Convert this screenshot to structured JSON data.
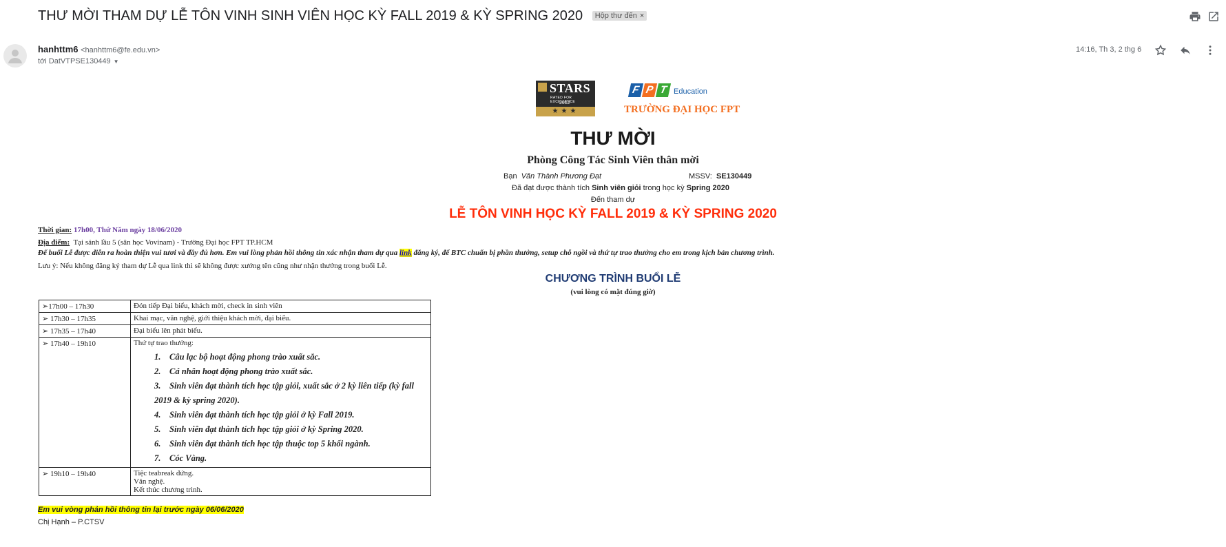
{
  "email": {
    "subject": "THƯ MỜI THAM DỰ LỄ TÔN VINH SINH VIÊN HỌC KỲ FALL 2019 & KỲ SPRING 2020",
    "label": "Hộp thư đến",
    "label_close": "×",
    "sender_name": "hanhttm6",
    "sender_email": "<hanhttm6@fe.edu.vn>",
    "recipient": "tới DatVTPSE130449",
    "time": "14:16, Th 3, 2 thg 6"
  },
  "logos": {
    "stars_text": "STARS",
    "stars_sub": "RATED FOR EXCELLENCE",
    "stars_year": "2012",
    "stars_rating": "★★★",
    "fpt_letters": [
      "F",
      "P",
      "T"
    ],
    "fpt_education": "Education",
    "fpt_university": "TRƯỜNG ĐẠI HỌC FPT"
  },
  "letter": {
    "title": "THƯ MỜI",
    "org_line": "Phòng Công Tác Sinh Viên thân mời",
    "ban_label": "Bạn",
    "student_name": "Văn Thành Phương Đạt",
    "mssv_label": "MSSV:",
    "mssv": "SE130449",
    "achievement_prefix": "Đã đạt được thành tích",
    "achievement": "Sinh viên giỏi",
    "term_prefix": "trong học kỳ",
    "term": "Spring 2020",
    "attend": "Đến tham dự",
    "event_title": "LỄ TÔN VINH HỌC KỲ FALL 2019 & KỲ SPRING 2020",
    "time_label": "Thời gian:",
    "time_value": "17h00, Thứ Năm ngày 18/06/2020",
    "place_label": "Địa điểm:",
    "place_value": "Tại sảnh lầu 5 (sân học Vovinam) - Trường Đại học FPT TP.HCM",
    "request_before": "Để buổi Lễ được diễn ra hoàn thiện vui tươi và đầy đủ hơn. Em vui lòng phản hồi thông tin xác nhận tham dự qua",
    "request_link": "link",
    "request_after": "đăng ký, để BTC chuẩn bị phần thưởng, setup chỗ ngồi và thứ tự trao thưởng cho em trong kịch bản chương trình.",
    "note": "Lưu ý: Nếu không đăng ký tham dự Lễ qua link thì sẽ không được xướng tên cũng như nhận thưởng trong buổi Lễ.",
    "program_title": "CHƯƠNG TRÌNH BUỔI LỄ",
    "program_sub": "(vui lòng có mặt đúng giờ)",
    "deadline": "Em vui vòng phản hồi thông tin lại trước ngày 06/06/2020",
    "signature": "Chị Hạnh – P.CTSV"
  },
  "schedule": [
    {
      "time": "➢17h00 – 17h30",
      "lines": [
        "Đón tiếp Đại biểu, khách mời, check in sinh viên"
      ]
    },
    {
      "time": "➢ 17h30 – 17h35",
      "lines": [
        "Khai mạc, văn nghệ, giới thiệu khách mời, đại biểu."
      ]
    },
    {
      "time": "➢ 17h35 – 17h40",
      "lines": [
        "Đại biểu lên phát biểu."
      ]
    },
    {
      "time": "➢ 17h40 – 19h10",
      "lines": [
        "Thứ tự trao thưởng:"
      ]
    },
    {
      "time": "➢ 19h10 – 19h40",
      "lines": [
        "Tiệc teabreak đứng.",
        "Văn nghệ.",
        "Kết thúc chương trình."
      ]
    }
  ],
  "awards": [
    {
      "n": "1.",
      "text": "Câu lạc bộ hoạt động phong trào xuất sắc."
    },
    {
      "n": "2.",
      "text": "Cá nhân hoạt động phong trào xuất sắc."
    },
    {
      "n": "3.",
      "text": "Sinh viên đạt thành tích học tập giỏi, xuất sắc ở 2 kỳ liên tiếp (kỳ fall 2019 & kỳ spring 2020)."
    },
    {
      "n": "4.",
      "text": "Sinh viên đạt thành tích học tập giỏi ở kỳ Fall 2019."
    },
    {
      "n": "5.",
      "text": "Sinh viên đạt thành tích học tập giỏi ở kỳ Spring 2020."
    },
    {
      "n": "6.",
      "text": "Sinh viên đạt thành tích học tập thuộc top 5 khối ngành."
    },
    {
      "n": "7.",
      "text": "Cóc Vàng."
    }
  ],
  "icons": [
    "print-icon",
    "open-new-window-icon",
    "star-icon",
    "reply-icon",
    "more-vert-icon",
    "avatar-icon",
    "dropdown-caret-icon"
  ],
  "colors": {
    "event_red": "#ff2d0a",
    "time_purple": "#6b3fa0",
    "highlight": "#ffff00",
    "program_blue": "#1f3b73",
    "fpt_orange": "#f36f21"
  }
}
